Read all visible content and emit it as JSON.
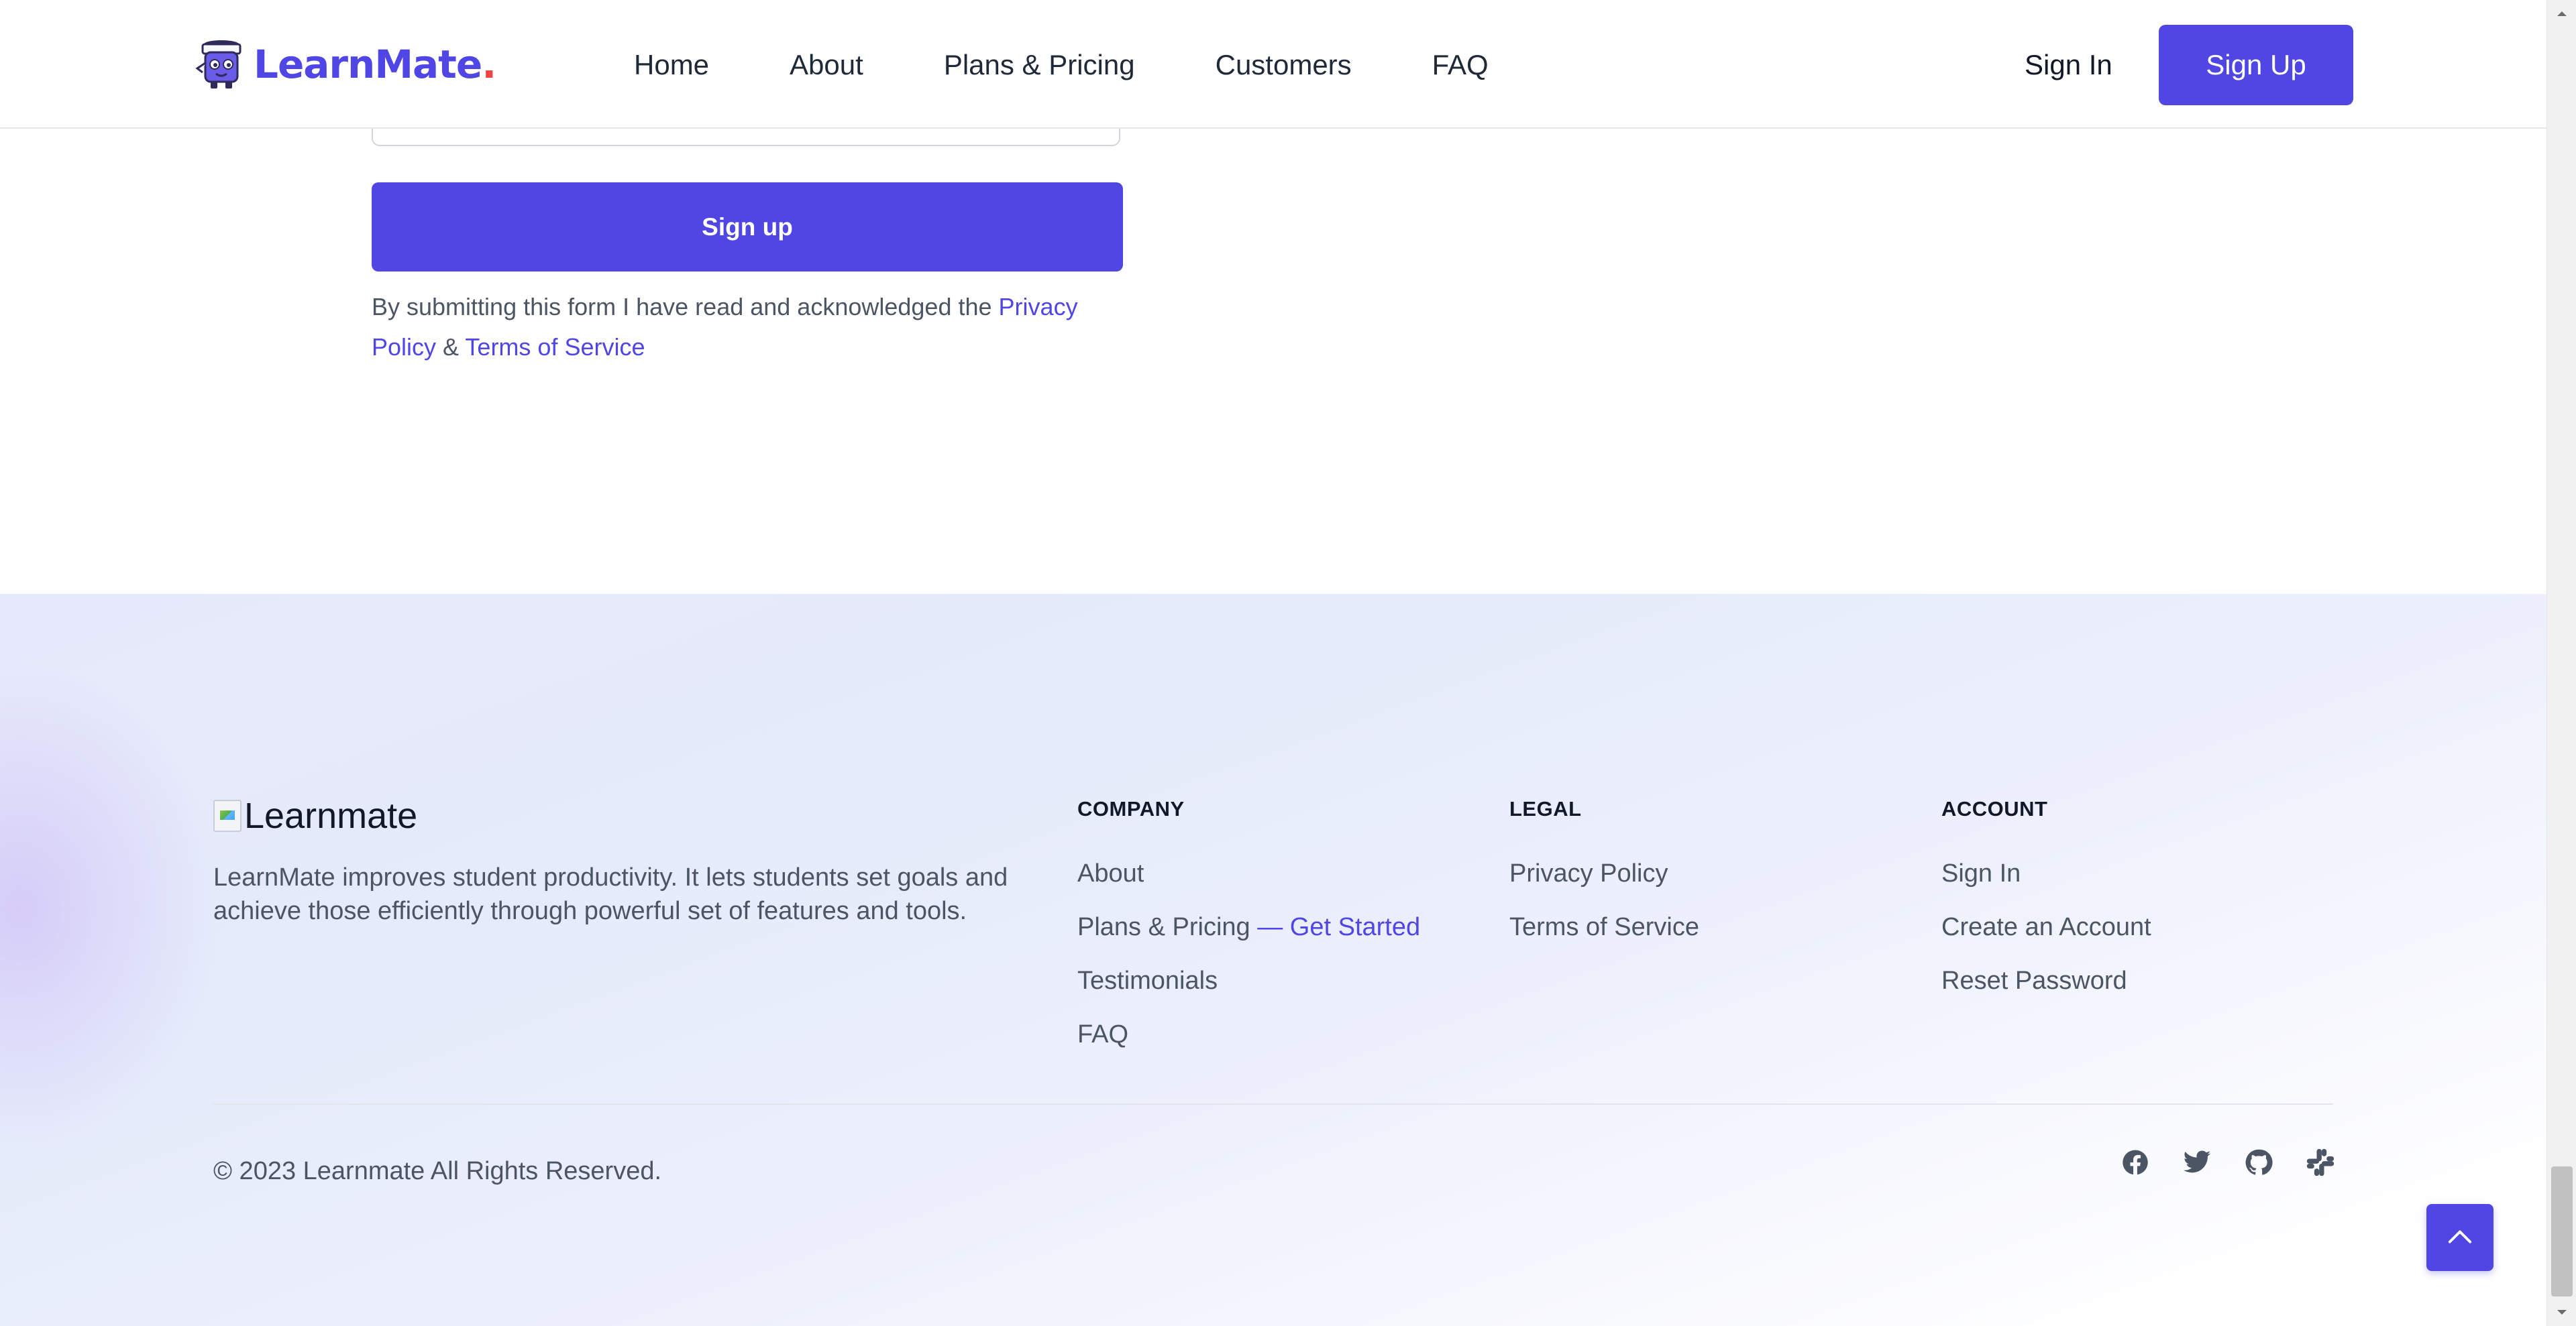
{
  "header": {
    "brand": {
      "name": "LearnMate",
      "dot": "."
    },
    "nav": [
      "Home",
      "About",
      "Plans & Pricing",
      "Customers",
      "FAQ"
    ],
    "sign_in": "Sign In",
    "sign_up": "Sign Up"
  },
  "form": {
    "submit_label": "Sign up",
    "consent": {
      "prefix": "By submitting this form I have read and acknowledged the",
      "privacy_link": "Privacy Policy",
      "joiner": "&",
      "terms_link": "Terms of Service"
    }
  },
  "footer": {
    "logo_alt": "Learnmate",
    "about": "LearnMate improves student productivity. It lets students set goals and achieve those efficiently through powerful set of features and tools.",
    "columns": {
      "company": {
        "heading": "COMPANY",
        "about": "About",
        "pricing": "Plans & Pricing",
        "pricing_dash": "—",
        "pricing_cta": "Get Started",
        "testimonials": "Testimonials",
        "faq": "FAQ"
      },
      "legal": {
        "heading": "LEGAL",
        "privacy": "Privacy Policy",
        "terms": "Terms of Service"
      },
      "account": {
        "heading": "ACCOUNT",
        "sign_in": "Sign In",
        "create": "Create an Account",
        "reset": "Reset Password"
      }
    },
    "copyright": "© 2023 Learnmate All Rights Reserved.",
    "social_icons": [
      "facebook-icon",
      "twitter-icon",
      "github-icon",
      "slack-icon"
    ]
  },
  "colors": {
    "accent": "#5046e4",
    "link": "#4f46e5",
    "text_muted": "#4b5563",
    "brand_dot": "#ef4444"
  }
}
